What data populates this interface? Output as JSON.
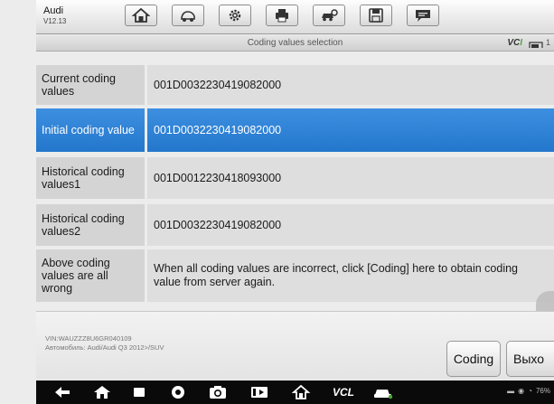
{
  "app": {
    "brand": "Audi",
    "version": "V12.13"
  },
  "toolbar": {
    "buttons": [
      "home-icon",
      "vehicle-icon",
      "settings-icon",
      "print-icon",
      "vehicle-swap-icon",
      "save-icon",
      "message-icon"
    ]
  },
  "titlebar": {
    "title": "Coding values selection",
    "vci_prefix": "VC",
    "vci_suffix": "I",
    "battery_partial": "1"
  },
  "rows": [
    {
      "label": "Current coding values",
      "value": "001D0032230419082000",
      "selected": false
    },
    {
      "label": "Initial coding value",
      "value": "001D0032230419082000",
      "selected": true
    },
    {
      "label": "Historical coding values1",
      "value": "001D0012230418093000",
      "selected": false
    },
    {
      "label": "Historical coding values2",
      "value": "001D0032230419082000",
      "selected": false
    },
    {
      "label": "Above coding values are all wrong",
      "value": "When all coding values are incorrect, click [Coding] here to obtain coding value from server again.",
      "selected": false
    }
  ],
  "footer": {
    "vin_line": "VIN:WAUZZZ8U6GR040109",
    "vehicle_line": "Автомобиль: Audi/Audi Q3 2012>/SUV",
    "coding_button": "Coding",
    "exit_button": "Выхо"
  },
  "navbar": {
    "vcl_label": "VCL",
    "status_text": "76%"
  },
  "colors": {
    "selected_row": "#2a7fd4",
    "vci_green": "#4aa83a"
  }
}
